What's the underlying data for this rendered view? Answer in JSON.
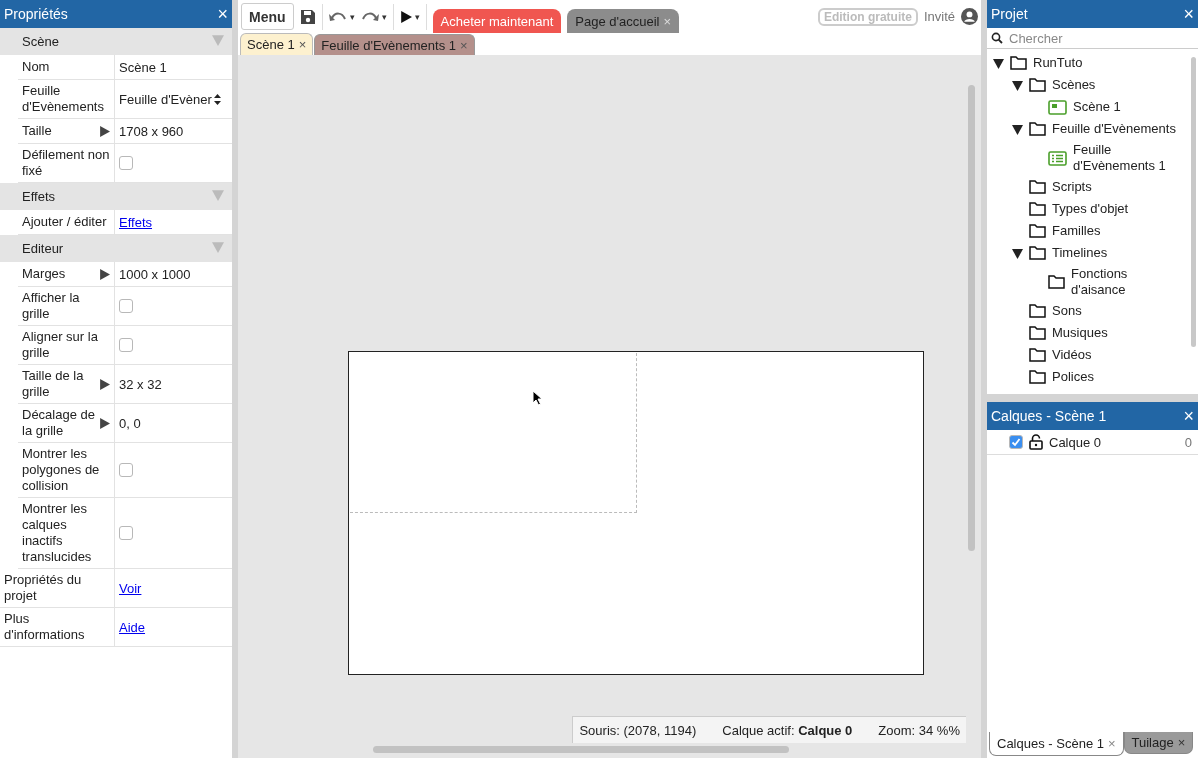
{
  "properties_panel": {
    "title": "Propriétés",
    "close": "×",
    "sections": [
      {
        "title": "Scène",
        "expanded": true,
        "rows": [
          {
            "kind": "text",
            "label": "Nom",
            "value": "Scène 1"
          },
          {
            "kind": "select",
            "label": "Feuille d'Evènements",
            "value": "Feuille d'Evèner"
          },
          {
            "kind": "expand",
            "label": "Taille",
            "value": "1708 x 960"
          },
          {
            "kind": "checkbox",
            "label": "Défilement non fixé",
            "checked": false
          }
        ]
      },
      {
        "title": "Effets",
        "expanded": true,
        "rows": [
          {
            "kind": "link",
            "label": "Ajouter / éditer",
            "value": "Effets"
          }
        ]
      },
      {
        "title": "Editeur",
        "expanded": true,
        "rows": [
          {
            "kind": "expand",
            "label": "Marges",
            "value": "1000 x 1000"
          },
          {
            "kind": "checkbox",
            "label": "Afficher la grille",
            "checked": false
          },
          {
            "kind": "checkbox",
            "label": "Aligner sur la grille",
            "checked": false
          },
          {
            "kind": "expand",
            "label": "Taille de la grille",
            "value": "32 x 32"
          },
          {
            "kind": "expand",
            "label": "Décalage de la grille",
            "value": "0, 0"
          },
          {
            "kind": "checkbox",
            "label": "Montrer les polygones de collision",
            "checked": false
          },
          {
            "kind": "checkbox",
            "label": "Montrer les calques inactifs translucides",
            "checked": false
          }
        ]
      }
    ],
    "footer_rows": [
      {
        "kind": "link",
        "label": "Propriétés du projet",
        "value": "Voir"
      },
      {
        "kind": "link",
        "label": "Plus d'informations",
        "value": "Aide"
      }
    ]
  },
  "toolbar": {
    "menu": "Menu",
    "play_caret": "▾",
    "undo_caret": "▾",
    "redo_caret": "▾",
    "promo_tabs": [
      {
        "label": "Acheter maintenant",
        "color": "#f05650"
      },
      {
        "label": "Page d'accueil",
        "close": "×",
        "color": "#8c8c8c"
      }
    ],
    "edition_badge": "Edition gratuite",
    "user": "Invité"
  },
  "editor_tabs": [
    {
      "label": "Scène 1",
      "close": "×",
      "selected": true,
      "color": "#fdf1cf"
    },
    {
      "label": "Feuille d'Evènements 1",
      "close": "×",
      "selected": false,
      "color": "#b4908b"
    }
  ],
  "status_bar": {
    "mouse": "Souris: (2078, 1194)",
    "layer": "Calque actif: **Calque 0**",
    "zoom": "Zoom: 34 %%"
  },
  "project_panel": {
    "title": "Projet",
    "close": "×",
    "search": {
      "placeholder": "Chercher"
    },
    "tree": [
      {
        "label": "RunTuto",
        "kind": "folder",
        "expanded": true,
        "children": [
          {
            "label": "Scènes",
            "kind": "folder",
            "expanded": true,
            "children": [
              {
                "label": "Scène 1",
                "kind": "scene"
              }
            ]
          },
          {
            "label": "Feuille d'Evènements",
            "kind": "folder",
            "expanded": true,
            "children": [
              {
                "label": "Feuille d'Evènements 1",
                "kind": "events"
              }
            ]
          },
          {
            "label": "Scripts",
            "kind": "folder"
          },
          {
            "label": "Types d'objet",
            "kind": "folder"
          },
          {
            "label": "Familles",
            "kind": "folder"
          },
          {
            "label": "Timelines",
            "kind": "folder",
            "expanded": true,
            "children": [
              {
                "label": "Fonctions d'aisance",
                "kind": "folder"
              }
            ]
          },
          {
            "label": "Sons",
            "kind": "folder"
          },
          {
            "label": "Musiques",
            "kind": "folder"
          },
          {
            "label": "Vidéos",
            "kind": "folder"
          },
          {
            "label": "Polices",
            "kind": "folder"
          }
        ]
      }
    ]
  },
  "layers_panel": {
    "title": "Calques - Scène 1",
    "close": "×",
    "layers": [
      {
        "name": "Calque 0",
        "visible": true,
        "locked": false,
        "index": "0"
      }
    ]
  },
  "bottom_tabs": [
    {
      "label": "Calques - Scène 1",
      "close": "×",
      "selected": true
    },
    {
      "label": "Tuilage",
      "close": "×",
      "selected": false
    }
  ]
}
